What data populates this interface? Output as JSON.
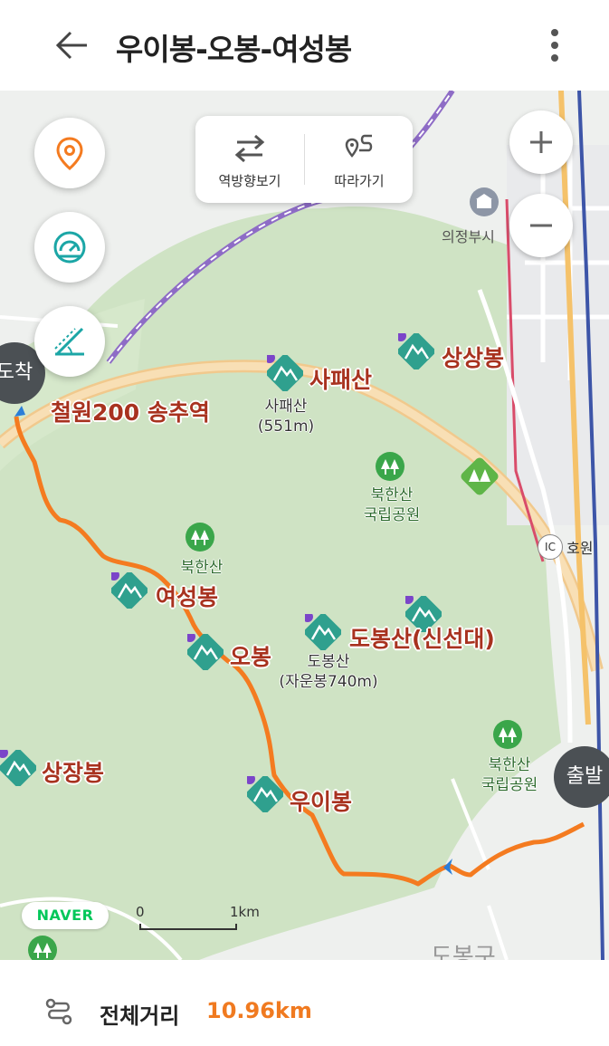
{
  "header": {
    "title": "우이봉-오봉-여성봉",
    "back_icon": "arrow-left-icon",
    "more_icon": "more-vertical-icon"
  },
  "toolbar": {
    "reverse_label": "역방향보기",
    "follow_label": "따라가기"
  },
  "map_controls": {
    "zoom_in": "+",
    "zoom_out": "−"
  },
  "map": {
    "places": {
      "sapaesan": "사패산",
      "sapaesan_sub1": "사패산",
      "sapaesan_sub2": "(551m)",
      "sangsangbong": "상상봉",
      "songchu": "철원200 송추역",
      "bukhansan1_l1": "북한산",
      "bukhansan1_l2": "국립공원",
      "bukhansan2": "북한산",
      "yeoseongbong": "여성봉",
      "obong": "오봉",
      "dobongsan": "도봉산(신선대)",
      "dobongsan_sub1": "도봉산",
      "dobongsan_sub2": "(자운봉740m)",
      "sangjangbong": "상장봉",
      "uibong": "우이봉",
      "bukhansan3_l1": "북한산",
      "bukhansan3_l2": "국립공원",
      "uijeongbu": "의정부시",
      "howon_ic": "IC",
      "howon": "호원",
      "dobong_gu": "도봉구"
    },
    "start_marker": "출발",
    "end_marker": "도착",
    "brand": "NAVER",
    "scale": {
      "zero": "0",
      "unit": "1km"
    },
    "colors": {
      "route": "#f47b20",
      "park": "#cfe3c4",
      "peak_icon": "#2fa08e",
      "road": "#f5d9a8"
    }
  },
  "footer": {
    "label": "전체거리",
    "value": "10.96km",
    "icon": "route-icon"
  }
}
